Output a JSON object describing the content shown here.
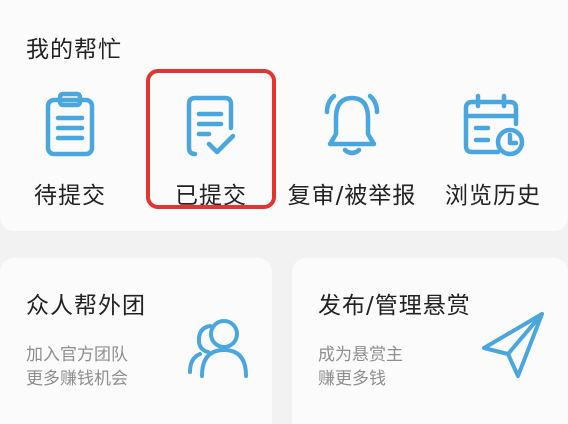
{
  "my_help": {
    "title": "我的帮忙",
    "items": [
      {
        "label": "待提交",
        "icon": "clipboard-list-icon"
      },
      {
        "label": "已提交",
        "icon": "document-check-icon",
        "selected": true
      },
      {
        "label": "复审/被举报",
        "icon": "bell-icon"
      },
      {
        "label": "浏览历史",
        "icon": "calendar-clock-icon"
      }
    ]
  },
  "team_card": {
    "title": "众人帮外团",
    "subtitle_line1": "加入官方团队",
    "subtitle_line2": "更多赚钱机会",
    "icon": "people-icon"
  },
  "publish_card": {
    "title": "发布/管理悬赏",
    "subtitle_line1": "成为悬赏主",
    "subtitle_line2": "赚更多钱",
    "icon": "paper-plane-icon"
  },
  "colors": {
    "icon_blue": "#4aa6de",
    "highlight_red": "#e3342f",
    "text_dark": "#222222",
    "text_gray": "#8f8f8f"
  }
}
